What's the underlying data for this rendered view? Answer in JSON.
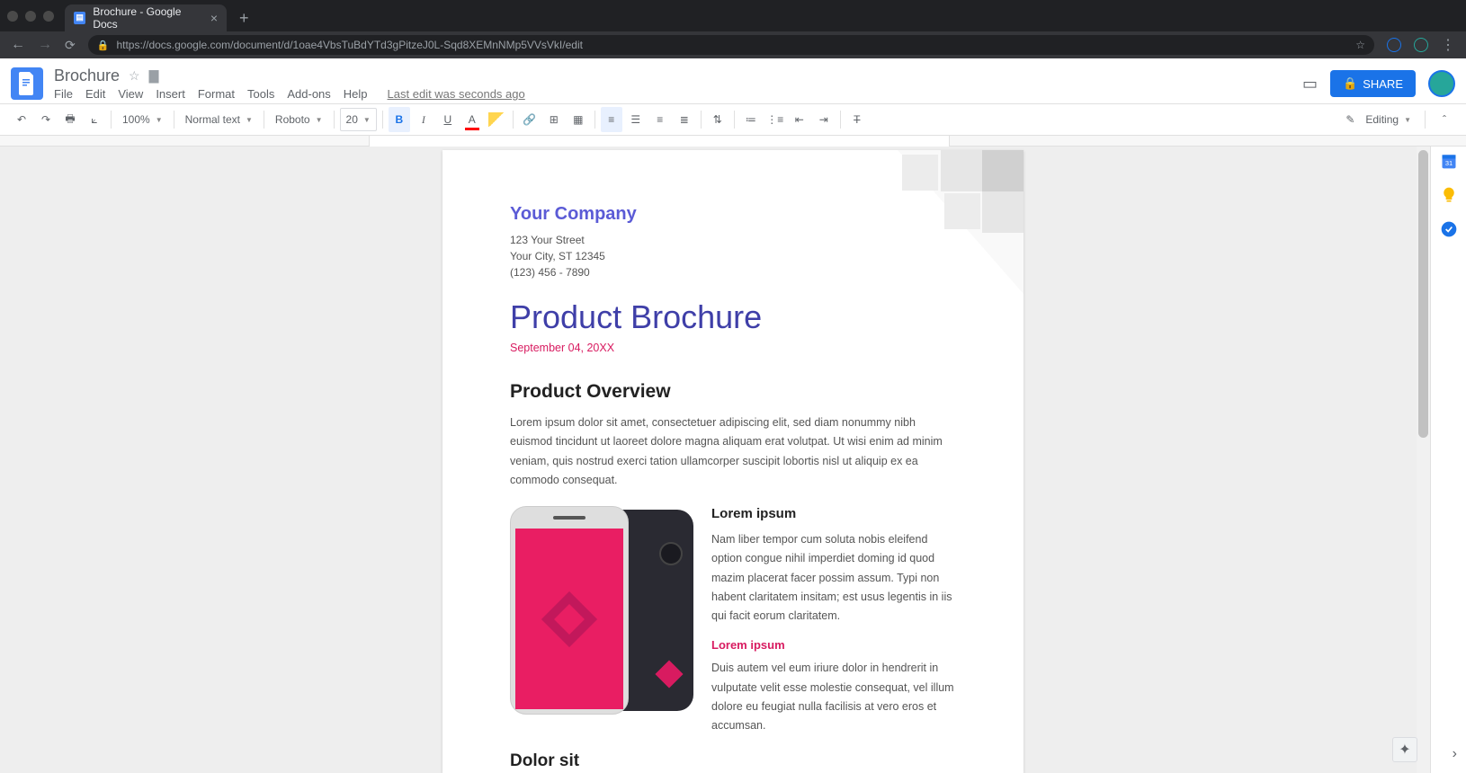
{
  "browser": {
    "tab_title": "Brochure - Google Docs",
    "url": "https://docs.google.com/document/d/1oae4VbsTuBdYTd3gPitzeJ0L-Sqd8XEMnNMp5VVsVkI/edit"
  },
  "header": {
    "doc_title": "Brochure",
    "menus": [
      "File",
      "Edit",
      "View",
      "Insert",
      "Format",
      "Tools",
      "Add-ons",
      "Help"
    ],
    "last_edit": "Last edit was seconds ago",
    "share_label": "SHARE"
  },
  "toolbar": {
    "zoom": "100%",
    "style": "Normal text",
    "font": "Roboto",
    "size": "20",
    "editing_label": "Editing"
  },
  "document": {
    "company": "Your Company",
    "addr1": "123 Your Street",
    "addr2": "Your City, ST 12345",
    "addr3": "(123) 456 - 7890",
    "title": "Product Brochure",
    "date": "September 04, 20XX",
    "overview_heading": "Product Overview",
    "overview_body": "Lorem ipsum dolor sit amet, consectetuer adipiscing elit, sed diam nonummy nibh euismod tincidunt ut laoreet dolore magna aliquam erat volutpat. Ut wisi enim ad minim veniam, quis nostrud exerci tation ullamcorper suscipit lobortis nisl ut aliquip ex ea commodo consequat.",
    "sec1_heading": "Lorem ipsum",
    "sec1_body": "Nam liber tempor cum soluta nobis eleifend option congue nihil imperdiet doming id quod mazim placerat facer possim assum. Typi non habent claritatem insitam; est usus legentis in iis qui facit eorum claritatem.",
    "sec1_sub": "Lorem ipsum",
    "sec1_sub_body": "Duis autem vel eum iriure dolor in hendrerit in vulputate velit esse molestie consequat, vel illum dolore eu feugiat nulla facilisis at vero eros et accumsan.",
    "sec2_heading": "Dolor sit"
  }
}
